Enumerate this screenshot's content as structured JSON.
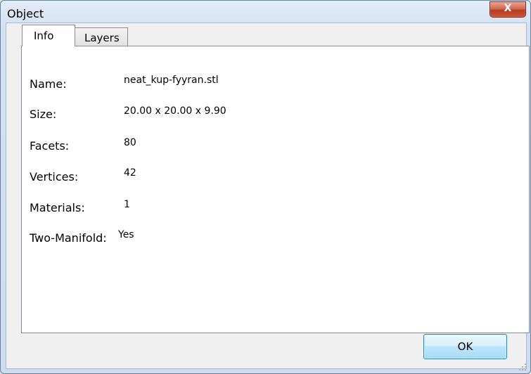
{
  "window": {
    "title": "Object"
  },
  "tabs": [
    {
      "label": "Info",
      "selected": true
    },
    {
      "label": "Layers",
      "selected": false
    }
  ],
  "info": {
    "rows": [
      {
        "label": "Name:",
        "value": "neat_kup-fyyran.stl"
      },
      {
        "label": "Size:",
        "value": "20.00 x 20.00 x 9.90"
      },
      {
        "label": "Facets:",
        "value": "80"
      },
      {
        "label": "Vertices:",
        "value": "42"
      },
      {
        "label": "Materials:",
        "value": "1"
      },
      {
        "label": "Two-Manifold:",
        "value": "Yes"
      }
    ]
  },
  "buttons": {
    "ok": "OK",
    "close_glyph": "X"
  },
  "icons": {
    "close": "close-icon",
    "resize": "resize-grip-icon"
  },
  "colors": {
    "close_button": "#c8573c",
    "ok_button_border": "#3c7fb1"
  }
}
